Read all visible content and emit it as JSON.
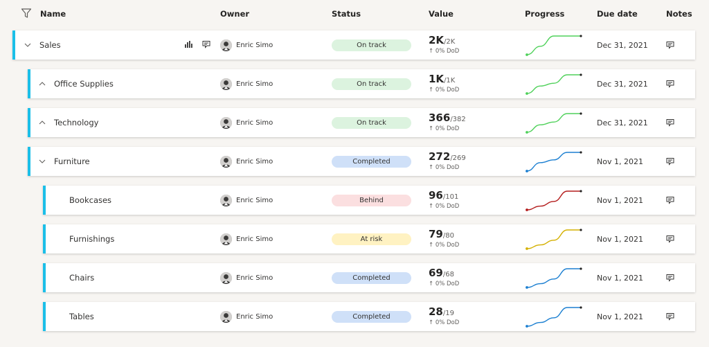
{
  "header": {
    "name": "Name",
    "owner": "Owner",
    "status": "Status",
    "value": "Value",
    "progress": "Progress",
    "due_date": "Due date",
    "notes": "Notes"
  },
  "icons": {
    "filter": "filter-icon",
    "chevron_expanded": "chevron-down-icon",
    "chevron_collapsed": "chevron-up-icon",
    "bar_chart": "bar-chart-icon",
    "add_note": "add-note-icon",
    "note": "note-icon",
    "avatar": "avatar"
  },
  "colors": {
    "accent": "#1bbfe8",
    "on_track": "#dcf3df",
    "completed": "#cfe0f8",
    "behind": "#fbdfe0",
    "at_risk": "#fff2c2",
    "line_green": "#4fd15a",
    "line_blue": "#1b7fd1",
    "line_red": "#b31b1b",
    "line_yellow": "#d4b000"
  },
  "rows": [
    {
      "name": "Sales",
      "level": 0,
      "chevron": "down",
      "show_actions": true,
      "owner": "Enric Simo",
      "status": "On track",
      "status_kind": "on_track",
      "value": "2K",
      "target": "/2K",
      "change": "↑ 0% DoD",
      "progress": [
        0,
        0.45,
        1,
        1,
        1
      ],
      "progress_color": "line_green",
      "due_date": "Dec 31, 2021"
    },
    {
      "name": "Office Supplies",
      "level": 1,
      "chevron": "up",
      "show_actions": false,
      "owner": "Enric Simo",
      "status": "On track",
      "status_kind": "on_track",
      "value": "1K",
      "target": "/1K",
      "change": "↑ 0% DoD",
      "progress": [
        0,
        0.4,
        0.55,
        1,
        1
      ],
      "progress_color": "line_green",
      "due_date": "Dec 31, 2021"
    },
    {
      "name": "Technology",
      "level": 1,
      "chevron": "up",
      "show_actions": false,
      "owner": "Enric Simo",
      "status": "On track",
      "status_kind": "on_track",
      "value": "366",
      "target": "/382",
      "change": "↑ 0% DoD",
      "progress": [
        0,
        0.4,
        0.55,
        1,
        1
      ],
      "progress_color": "line_green",
      "due_date": "Dec 31, 2021"
    },
    {
      "name": "Furniture",
      "level": 1,
      "chevron": "down",
      "show_actions": false,
      "owner": "Enric Simo",
      "status": "Completed",
      "status_kind": "completed",
      "value": "272",
      "target": "/269",
      "change": "↑ 0% DoD",
      "progress": [
        0,
        0.45,
        0.6,
        1,
        1
      ],
      "progress_color": "line_blue",
      "due_date": "Nov 1, 2021"
    },
    {
      "name": "Bookcases",
      "level": 2,
      "chevron": "none",
      "show_actions": false,
      "owner": "Enric Simo",
      "status": "Behind",
      "status_kind": "behind",
      "value": "96",
      "target": "/101",
      "change": "↑ 0% DoD",
      "progress": [
        0,
        0.2,
        0.45,
        1,
        1
      ],
      "progress_color": "line_red",
      "due_date": "Nov 1, 2021"
    },
    {
      "name": "Furnishings",
      "level": 2,
      "chevron": "none",
      "show_actions": false,
      "owner": "Enric Simo",
      "status": "At risk",
      "status_kind": "at_risk",
      "value": "79",
      "target": "/80",
      "change": "↑ 0% DoD",
      "progress": [
        0,
        0.2,
        0.45,
        1,
        1
      ],
      "progress_color": "line_yellow",
      "due_date": "Nov 1, 2021"
    },
    {
      "name": "Chairs",
      "level": 2,
      "chevron": "none",
      "show_actions": false,
      "owner": "Enric Simo",
      "status": "Completed",
      "status_kind": "completed",
      "value": "69",
      "target": "/68",
      "change": "↑ 0% DoD",
      "progress": [
        0,
        0.2,
        0.45,
        1,
        1
      ],
      "progress_color": "line_blue",
      "due_date": "Nov 1, 2021"
    },
    {
      "name": "Tables",
      "level": 2,
      "chevron": "none",
      "show_actions": false,
      "owner": "Enric Simo",
      "status": "Completed",
      "status_kind": "completed",
      "value": "28",
      "target": "/19",
      "change": "↑ 0% DoD",
      "progress": [
        0,
        0.2,
        0.45,
        1,
        1
      ],
      "progress_color": "line_blue",
      "due_date": "Nov 1, 2021"
    }
  ]
}
